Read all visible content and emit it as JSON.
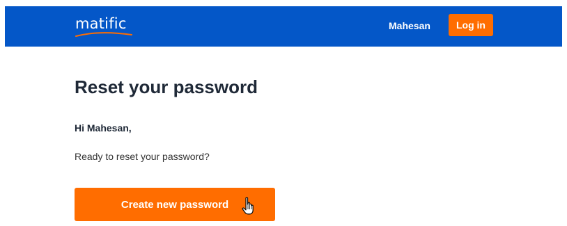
{
  "header": {
    "logo_text": "matific",
    "user_name": "Mahesan",
    "login_label": "Log in"
  },
  "main": {
    "title": "Reset your password",
    "greeting": "Hi Mahesan,",
    "message": "Ready to reset your password?",
    "cta_label": "Create new password"
  },
  "colors": {
    "header_bg": "#0457c8",
    "accent": "#ff6d00",
    "text": "#1f2937"
  },
  "icons": {
    "logo_swoosh": "orange-swoosh",
    "cursor": "hand-pointer-icon"
  }
}
